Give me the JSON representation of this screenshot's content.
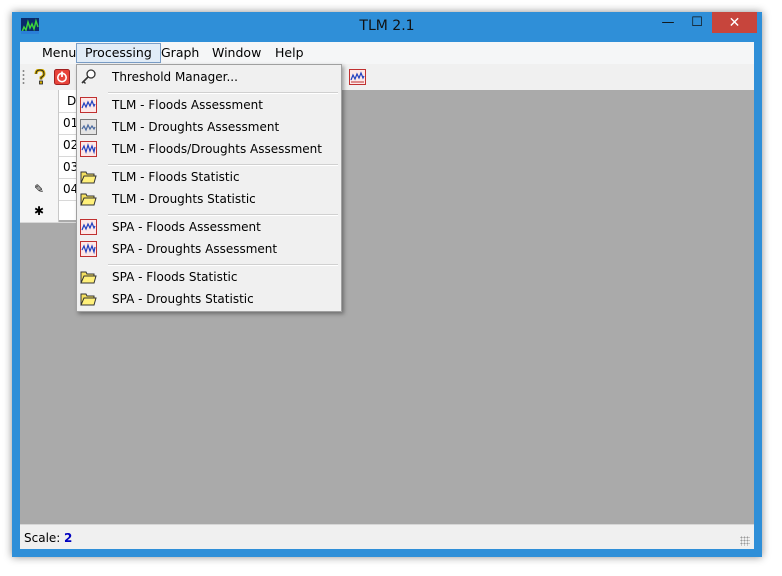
{
  "window": {
    "title": "TLM 2.1",
    "controls": {
      "minimize": "—",
      "maximize": "☐",
      "close": "✕"
    }
  },
  "menubar": {
    "items": [
      "Menu",
      "Processing",
      "Graph",
      "Window",
      "Help"
    ],
    "active": "Processing"
  },
  "toolbar": {
    "buttons": [
      "help-icon",
      "power-icon",
      "chart-icon"
    ]
  },
  "grid": {
    "column_header": "D",
    "rows": [
      {
        "marker": "",
        "value": "01"
      },
      {
        "marker": "",
        "value": "02"
      },
      {
        "marker": "",
        "value": "03"
      },
      {
        "marker": "✎",
        "value": "04"
      },
      {
        "marker": "✱",
        "value": ""
      }
    ]
  },
  "processing_menu": {
    "groups": [
      [
        {
          "label": "Threshold Manager...",
          "icon": "key-icon"
        }
      ],
      [
        {
          "label": "TLM - Floods Assessment",
          "icon": "chart-icon"
        },
        {
          "label": "TLM - Droughts Assessment",
          "icon": "chart-gray-icon"
        },
        {
          "label": "TLM - Floods/Droughts Assessment",
          "icon": "chart-icon"
        }
      ],
      [
        {
          "label": "TLM - Floods Statistic",
          "icon": "folder-icon"
        },
        {
          "label": "TLM - Droughts Statistic",
          "icon": "folder-icon"
        }
      ],
      [
        {
          "label": "SPA - Floods Assessment",
          "icon": "chart-icon"
        },
        {
          "label": "SPA - Droughts Assessment",
          "icon": "chart-icon"
        }
      ],
      [
        {
          "label": "SPA - Floods Statistic",
          "icon": "folder-icon"
        },
        {
          "label": "SPA - Droughts Statistic",
          "icon": "folder-icon"
        }
      ]
    ]
  },
  "statusbar": {
    "label": "Scale:",
    "value": "2"
  },
  "colors": {
    "frame": "#2f8fd8",
    "mdi_background": "#aaaaaa",
    "close_button": "#c7453c",
    "scale_value": "#0000c0"
  }
}
